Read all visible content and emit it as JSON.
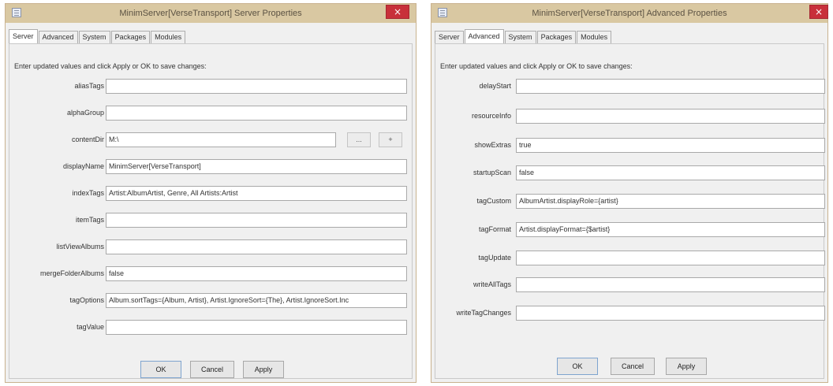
{
  "server_dialog": {
    "title": "MinimServer[VerseTransport] Server Properties",
    "close_glyph": "×",
    "tabs": [
      {
        "label": "Server",
        "active": true
      },
      {
        "label": "Advanced",
        "active": false
      },
      {
        "label": "System",
        "active": false
      },
      {
        "label": "Packages",
        "active": false
      },
      {
        "label": "Modules",
        "active": false
      }
    ],
    "instruction": "Enter updated values and click Apply or OK to save changes:",
    "fields": [
      {
        "label": "aliasTags",
        "value": ""
      },
      {
        "label": "alphaGroup",
        "value": ""
      },
      {
        "label": "contentDir",
        "value": "M:\\"
      },
      {
        "label": "displayName",
        "value": "MinimServer[VerseTransport]"
      },
      {
        "label": "indexTags",
        "value": "Artist:AlbumArtist, Genre, All Artists:Artist"
      },
      {
        "label": "itemTags",
        "value": ""
      },
      {
        "label": "listViewAlbums",
        "value": ""
      },
      {
        "label": "mergeFolderAlbums",
        "value": "false"
      },
      {
        "label": "tagOptions",
        "value": "Album.sortTags={Album, Artist}, Artist.IgnoreSort={The}, Artist.IgnoreSort.Inc"
      },
      {
        "label": "tagValue",
        "value": ""
      }
    ],
    "content_dir_buttons": [
      "...",
      "+"
    ],
    "buttons": {
      "ok": "OK",
      "cancel": "Cancel",
      "apply": "Apply"
    }
  },
  "advanced_dialog": {
    "title": "MinimServer[VerseTransport] Advanced Properties",
    "close_glyph": "×",
    "tabs": [
      {
        "label": "Server",
        "active": false
      },
      {
        "label": "Advanced",
        "active": true
      },
      {
        "label": "System",
        "active": false
      },
      {
        "label": "Packages",
        "active": false
      },
      {
        "label": "Modules",
        "active": false
      }
    ],
    "instruction": "Enter updated values and click Apply or OK to save changes:",
    "fields": [
      {
        "label": "delayStart",
        "value": ""
      },
      {
        "label": "resourceInfo",
        "value": ""
      },
      {
        "label": "showExtras",
        "value": "true"
      },
      {
        "label": "startupScan",
        "value": "false"
      },
      {
        "label": "tagCustom",
        "value": "AlbumArtist.displayRole={artist}"
      },
      {
        "label": "tagFormat",
        "value": "Artist.displayFormat={$artist}"
      },
      {
        "label": "tagUpdate",
        "value": ""
      },
      {
        "label": "writeAllTags",
        "value": ""
      },
      {
        "label": "writeTagChanges",
        "value": ""
      }
    ],
    "buttons": {
      "ok": "OK",
      "cancel": "Cancel",
      "apply": "Apply"
    }
  },
  "colors": {
    "titlebar": "#d9c8a2",
    "title_text": "#5b5243",
    "close_button": "#c8303a",
    "dialog_background": "#f0f0f0"
  }
}
